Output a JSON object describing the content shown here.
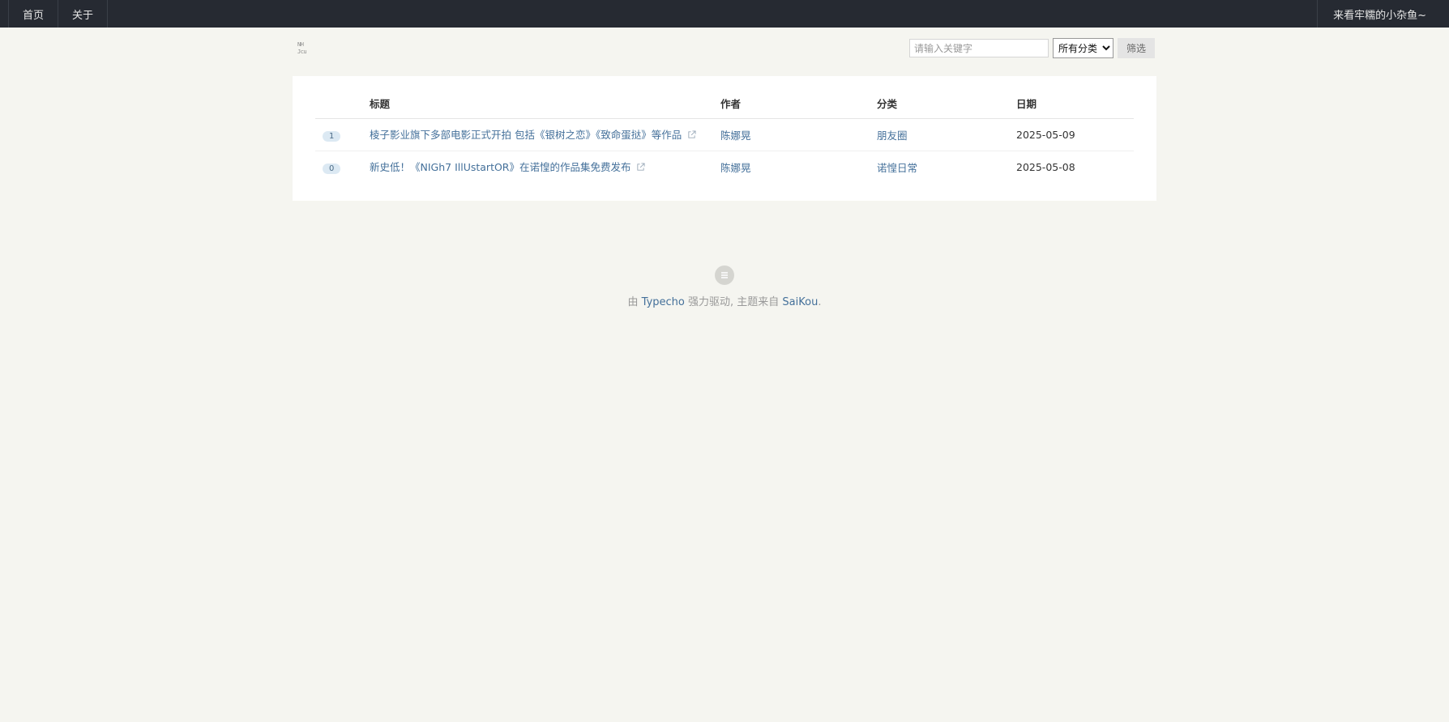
{
  "nav": {
    "items": [
      {
        "label": "首页"
      },
      {
        "label": "关于"
      }
    ],
    "user_label": "来看牢糯的小杂鱼~"
  },
  "logo_text": "NH Jcu",
  "filter": {
    "search_placeholder": "请输入关键字",
    "category_selected": "所有分类",
    "submit_label": "筛选"
  },
  "table": {
    "headers": {
      "title": "标题",
      "author": "作者",
      "category": "分类",
      "date": "日期"
    },
    "rows": [
      {
        "count": "1",
        "title": "棱子影业旗下多部电影正式开拍 包括《银树之恋》《致命蛋挞》等作品",
        "author": "陈娜晃",
        "category": "朋友圈",
        "date": "2025-05-09"
      },
      {
        "count": "0",
        "title": "新史低！《NIGh7 IllUstartOR》在诺惶的作品集免费发布",
        "author": "陈娜晃",
        "category": "诺惶日常",
        "date": "2025-05-08"
      }
    ]
  },
  "footer": {
    "prefix": "由",
    "engine": "Typecho",
    "middle": "强力驱动, 主题来自",
    "theme": "SaiKou",
    "suffix": "."
  }
}
